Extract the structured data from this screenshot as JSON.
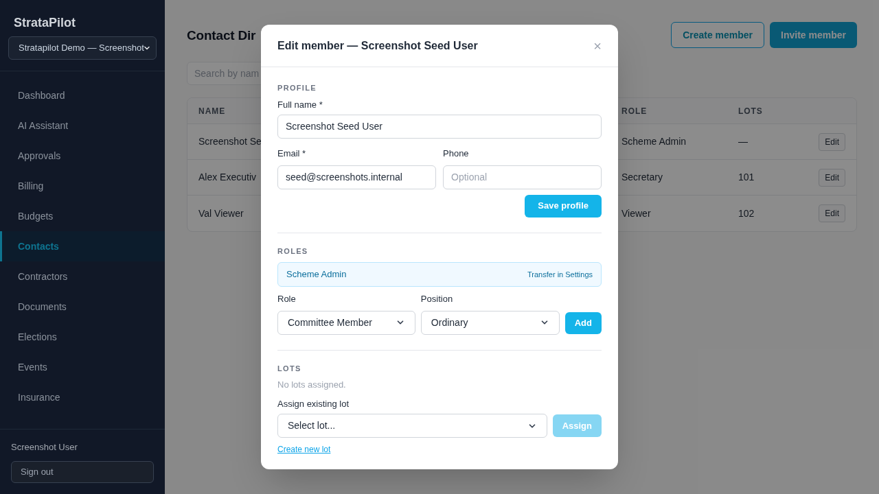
{
  "sidebar": {
    "brand": "StrataPilot",
    "scheme_select": "Stratapilot Demo — Screenshot",
    "nav": [
      {
        "label": "Dashboard",
        "selected": false
      },
      {
        "label": "AI Assistant",
        "selected": false
      },
      {
        "label": "Approvals",
        "selected": false
      },
      {
        "label": "Billing",
        "selected": false
      },
      {
        "label": "Budgets",
        "selected": false
      },
      {
        "label": "Contacts",
        "selected": true
      },
      {
        "label": "Contractors",
        "selected": false
      },
      {
        "label": "Documents",
        "selected": false
      },
      {
        "label": "Elections",
        "selected": false
      },
      {
        "label": "Events",
        "selected": false
      },
      {
        "label": "Insurance",
        "selected": false
      }
    ],
    "user_name": "Screenshot User",
    "sign_out": "Sign out"
  },
  "main": {
    "title": "Contact Dir",
    "buttons": [
      {
        "label": "Create member",
        "kind": "outline"
      },
      {
        "label": "Invite member",
        "kind": "primary"
      }
    ],
    "search": {
      "placeholder": "Search by nam"
    },
    "table": {
      "columns": [
        "NAME",
        "ROLE",
        "LOTS"
      ],
      "rows": [
        {
          "name": "Screenshot Se",
          "role": "Scheme Admin",
          "lots": "—",
          "action": "Edit"
        },
        {
          "name": "Alex Executiv",
          "role": "Secretary",
          "lots": "101",
          "action": "Edit"
        },
        {
          "name": "Val Viewer",
          "role": "Viewer",
          "lots": "102",
          "action": "Edit"
        }
      ]
    }
  },
  "modal": {
    "title": "Edit member — Screenshot Seed User",
    "close": "×",
    "profile": {
      "heading": "PROFILE",
      "full_name_label": "Full name *",
      "full_name": "Screenshot Seed User",
      "email_label": "Email *",
      "email": "seed@screenshots.internal",
      "phone_label": "Phone",
      "phone_placeholder": "Optional",
      "save": "Save profile"
    },
    "roles": {
      "heading": "ROLES",
      "current": {
        "role": "Scheme Admin",
        "link": "Transfer in Settings"
      },
      "role_label": "Role",
      "role_value": "Committee Member",
      "position_label": "Position",
      "position_value": "Ordinary",
      "add": "Add"
    },
    "lots": {
      "heading": "LOTS",
      "empty": "No lots assigned.",
      "assign_label": "Assign existing lot",
      "select_value": "Select lot...",
      "assign": {
        "label": "Assign",
        "disabled": true
      },
      "create_link": "Create new lot"
    }
  }
}
